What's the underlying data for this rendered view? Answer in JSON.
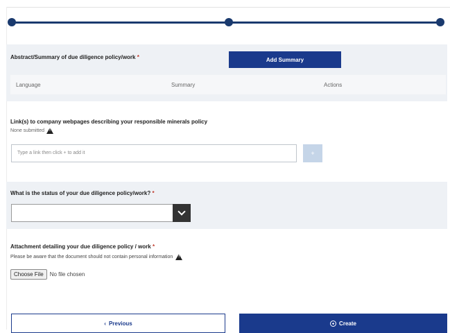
{
  "abstract": {
    "label": "Abstract/Summary of due diligence policy/work",
    "required_mark": "*",
    "add_button": "Add Summary",
    "columns": [
      "Language",
      "Summary",
      "Actions"
    ]
  },
  "links": {
    "label": "Link(s) to company webpages describing your responsible minerals policy",
    "none_submitted": "None submitted",
    "input_placeholder": "Type a link then click + to add it",
    "add_symbol": "+"
  },
  "status": {
    "label": "What is the status of your due diligence policy/work?",
    "required_mark": "*",
    "selected_value": ""
  },
  "attachment": {
    "label": "Attachment detailing your due diligence policy / work",
    "required_mark": "*",
    "note": "Please be aware that the document should not contain personal information",
    "choose_file": "Choose File",
    "no_file": "No file chosen"
  },
  "nav": {
    "previous_chevron": "‹",
    "previous": "Previous",
    "create": "Create"
  },
  "colors": {
    "primary": "#1a3a8c",
    "stepper": "#1a3a6e",
    "section_bg": "#eef1f5"
  }
}
